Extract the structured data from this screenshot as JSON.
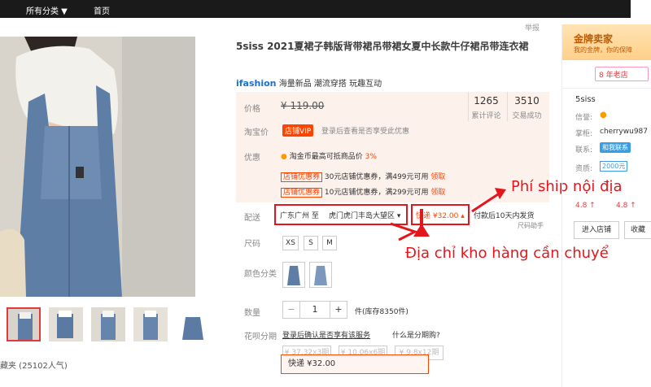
{
  "nav": {
    "all_categories": "所有分类 ▼",
    "home": "首页"
  },
  "report": "举报",
  "gallery": {
    "favorites": "藏夹 (25102人气)"
  },
  "product": {
    "title": "5siss 2021夏裙子韩版背带裙吊带裙女夏中长款牛仔裙吊带连衣裙",
    "brand_logo": "ifashion",
    "brand_tags": "海量新品 潮流穿搭 玩趣互动"
  },
  "price": {
    "label": "价格",
    "value": "¥ 119.00",
    "reviews_count": "1265",
    "reviews_label": "累计评论",
    "trades_count": "3510",
    "trades_label": "交易成功",
    "taobao_price_label": "淘宝价",
    "vip_badge": "店铺VIP",
    "vip_text": "登录后查看是否享受此优惠",
    "promo_label": "优惠",
    "promo_coin": "淘金币最高可抵商品价",
    "promo_coin_pct": "3%",
    "coupons": [
      {
        "tag": "店铺优惠券",
        "text": "30元店铺优惠券，满499元可用",
        "get": "领取"
      },
      {
        "tag": "店铺优惠券",
        "text": "10元店铺优惠券，满299元可用",
        "get": "领取"
      }
    ]
  },
  "shipping": {
    "label": "配送",
    "from": "广东广州 至",
    "to": "虎门虎门丰岛大望区 ▾",
    "fee": "快递 ¥32.00 ▴",
    "note": "付款后10天内发货",
    "assist": "尺码助手"
  },
  "size": {
    "label": "尺码",
    "options": [
      "XS",
      "S",
      "M"
    ]
  },
  "color": {
    "label": "颜色分类"
  },
  "quantity": {
    "label": "数量",
    "minus": "−",
    "value": "1",
    "plus": "+",
    "stock": "件(库存8350件)"
  },
  "installment": {
    "label": "花呗分期",
    "text": "登录后确认是否享有该服务",
    "what": "什么是分期购?",
    "options": [
      "¥ 37.32x3期",
      "¥ 10.06x6期",
      "¥ 9.8x12期"
    ],
    "popup": "快递 ¥32.00"
  },
  "annotations": {
    "fee": "Phí ship nội địa",
    "warehouse": "Địa chỉ kho hàng cần chuyể"
  },
  "seller": {
    "gold_title": "金牌卖家",
    "gold_sub": "我的金牌，你的保障",
    "years": "8 年老店",
    "name": "5siss",
    "credit_label": "信誉:",
    "wangwang_label": "掌柜:",
    "wangwang": "cherrywu987",
    "contact_label": "联系:",
    "contact_btn": "和我联系",
    "qual_label": "资质:",
    "deposit": "2000元",
    "score1": "4.8 ↑",
    "score2": "4.8 ↑",
    "enter_shop": "进入店铺",
    "collect": "收藏"
  },
  "colors": {
    "accent": "#ff4400",
    "annotation": "#e4161b"
  }
}
